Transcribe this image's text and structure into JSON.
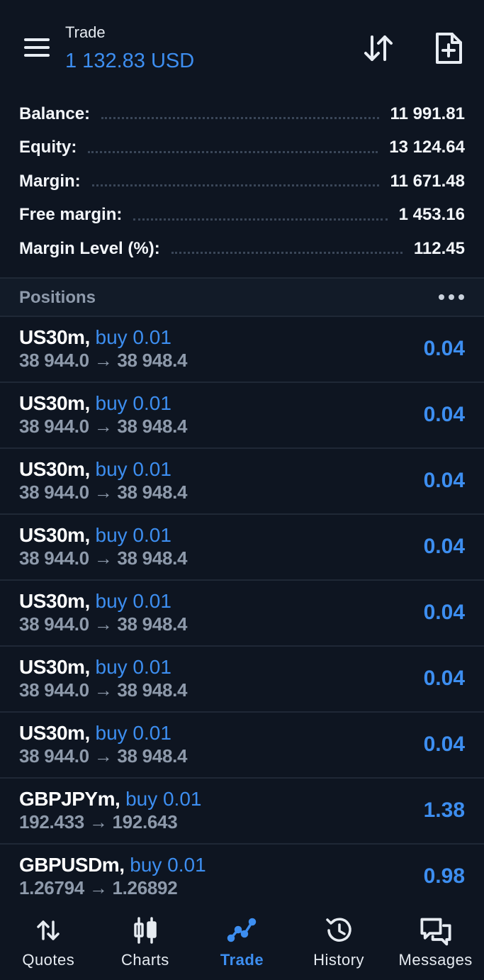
{
  "header": {
    "title": "Trade",
    "balance_line": "1 132.83 USD",
    "icons": [
      "menu-icon",
      "sort-icon",
      "new-order-icon"
    ]
  },
  "summary": [
    {
      "label": "Balance:",
      "value": "11 991.81"
    },
    {
      "label": "Equity:",
      "value": "13 124.64"
    },
    {
      "label": "Margin:",
      "value": "11 671.48"
    },
    {
      "label": "Free margin:",
      "value": "1 453.16"
    },
    {
      "label": "Margin Level (%):",
      "value": "112.45"
    }
  ],
  "positions": {
    "title": "Positions",
    "items": [
      {
        "symbol": "US30m,",
        "side": "buy 0.01",
        "open": "38 944.0",
        "arrow": "→",
        "current": "38 948.4",
        "profit": "0.04"
      },
      {
        "symbol": "US30m,",
        "side": "buy 0.01",
        "open": "38 944.0",
        "arrow": "→",
        "current": "38 948.4",
        "profit": "0.04"
      },
      {
        "symbol": "US30m,",
        "side": "buy 0.01",
        "open": "38 944.0",
        "arrow": "→",
        "current": "38 948.4",
        "profit": "0.04"
      },
      {
        "symbol": "US30m,",
        "side": "buy 0.01",
        "open": "38 944.0",
        "arrow": "→",
        "current": "38 948.4",
        "profit": "0.04"
      },
      {
        "symbol": "US30m,",
        "side": "buy 0.01",
        "open": "38 944.0",
        "arrow": "→",
        "current": "38 948.4",
        "profit": "0.04"
      },
      {
        "symbol": "US30m,",
        "side": "buy 0.01",
        "open": "38 944.0",
        "arrow": "→",
        "current": "38 948.4",
        "profit": "0.04"
      },
      {
        "symbol": "US30m,",
        "side": "buy 0.01",
        "open": "38 944.0",
        "arrow": "→",
        "current": "38 948.4",
        "profit": "0.04"
      },
      {
        "symbol": "GBPJPYm,",
        "side": "buy 0.01",
        "open": "192.433",
        "arrow": "→",
        "current": "192.643",
        "profit": "1.38"
      },
      {
        "symbol": "GBPUSDm,",
        "side": "buy 0.01",
        "open": "1.26794",
        "arrow": "→",
        "current": "1.26892",
        "profit": "0.98"
      }
    ]
  },
  "nav": [
    {
      "label": "Quotes",
      "icon": "quotes-icon",
      "active": false
    },
    {
      "label": "Charts",
      "icon": "charts-icon",
      "active": false
    },
    {
      "label": "Trade",
      "icon": "trade-icon",
      "active": true
    },
    {
      "label": "History",
      "icon": "history-icon",
      "active": false
    },
    {
      "label": "Messages",
      "icon": "messages-icon",
      "active": false
    }
  ],
  "colors": {
    "background": "#0e1521",
    "accent": "#3d8ef0",
    "muted": "#8e9aab",
    "divider": "#1f2836"
  }
}
